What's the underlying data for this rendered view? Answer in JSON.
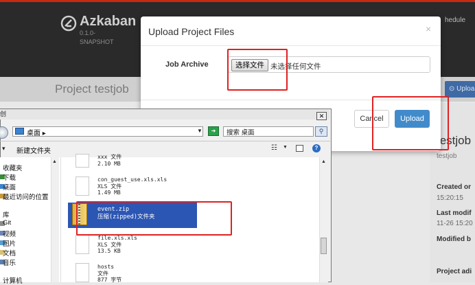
{
  "app": {
    "brand": "Azkaban",
    "version": "0.1.0-SNAPSHOT",
    "nav_schedule": "hedule",
    "project_title": "Project testjob",
    "upload_button": "Uploa",
    "project_name": "testjob",
    "project_sub": "testjob",
    "created_label": "Created or",
    "created_value": "15:20:15",
    "last_modified_label": "Last modif",
    "last_modified_value": "11-26 15:20",
    "modified_by_label": "Modified b",
    "project_admins_label": "Project adi"
  },
  "modal": {
    "title": "Upload Project Files",
    "close_glyph": "×",
    "job_archive_label": "Job Archive",
    "choose_file_label": "选择文件",
    "no_file_text": "未选择任何文件",
    "cancel_label": "Cancel",
    "upload_label": "Upload"
  },
  "file_dialog": {
    "title": "创",
    "close_glyph": "✕",
    "address": "桌面",
    "address_caret": "▸",
    "search_placeholder": "搜索 桌面",
    "organize_caret": "▾",
    "new_folder_label": "新建文件夹",
    "nav_items": [
      {
        "label": "收藏夹"
      },
      {
        "label": "下载"
      },
      {
        "label": "桌面"
      },
      {
        "label": "最近访问的位置"
      },
      {
        "label": "库"
      },
      {
        "label": "Git"
      },
      {
        "label": "视频"
      },
      {
        "label": "图片"
      },
      {
        "label": "文档"
      },
      {
        "label": "音乐"
      },
      {
        "label": "计算机"
      }
    ],
    "files": [
      {
        "name": "xxx 文件",
        "type": "",
        "size": "2.10 MB"
      },
      {
        "name": "con_guest_use.xls.xls",
        "type": "XLS 文件",
        "size": "1.49 MB"
      },
      {
        "name": "file.xls.xls",
        "type": "XLS 文件",
        "size": "13.5 KB"
      },
      {
        "name": "hosts",
        "type": "文件",
        "size": "877 字节"
      }
    ],
    "selected_file": {
      "name": "event.zip",
      "type": "压缩(zipped)文件夹"
    }
  },
  "colors": {
    "accent": "#428bca",
    "annotation": "#e02020",
    "topbar": "#2a2a2a"
  }
}
